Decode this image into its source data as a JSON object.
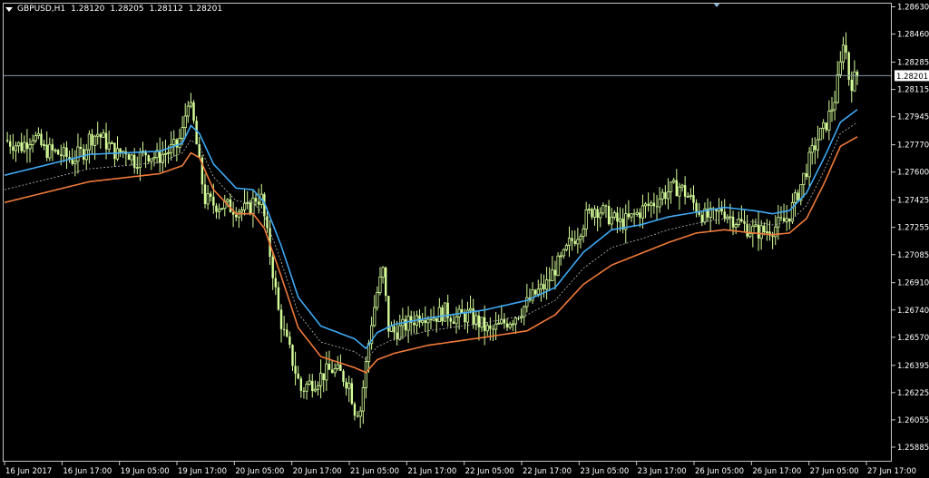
{
  "header": {
    "symbol": "GBPUSD,H1",
    "open": "1.28120",
    "high": "1.28205",
    "low": "1.28112",
    "close": "1.28201",
    "menu_icon": "triangle-down-icon"
  },
  "colors": {
    "background": "#000000",
    "candle": "#d6ff9a",
    "upper_band": "#3fa9f5",
    "lower_band": "#f07a3a",
    "middle_band": "#bbbbbb",
    "grid": "#c8c8c8",
    "current_price_line": "#8896a8"
  },
  "chart_data": {
    "type": "candlestick",
    "current_price": 1.28201,
    "current_price_label": "1.28201",
    "ylim": [
      1.258,
      1.2865
    ],
    "y_ticks": [
      "1.28630",
      "1.28460",
      "1.28285",
      "1.28115",
      "1.27945",
      "1.27770",
      "1.27600",
      "1.27425",
      "1.27255",
      "1.27085",
      "1.26910",
      "1.26740",
      "1.26570",
      "1.26395",
      "1.26225",
      "1.26055",
      "1.25885"
    ],
    "x_labels": [
      "16 Jun 2017",
      "16 Jun 17:00",
      "19 Jun 05:00",
      "19 Jun 17:00",
      "20 Jun 05:00",
      "20 Jun 17:00",
      "21 Jun 05:00",
      "21 Jun 17:00",
      "22 Jun 05:00",
      "22 Jun 17:00",
      "23 Jun 05:00",
      "23 Jun 17:00",
      "26 Jun 05:00",
      "26 Jun 17:00",
      "27 Jun 05:00",
      "27 Jun 17:00"
    ],
    "close_path": [
      [
        0,
        1.278
      ],
      [
        6,
        1.2776
      ],
      [
        10,
        1.2783
      ],
      [
        14,
        1.2774
      ],
      [
        20,
        1.2771
      ],
      [
        24,
        1.2768
      ],
      [
        28,
        1.2773
      ],
      [
        30,
        1.2781
      ],
      [
        33,
        1.2784
      ],
      [
        36,
        1.2778
      ],
      [
        40,
        1.2771
      ],
      [
        43,
        1.2774
      ],
      [
        46,
        1.2767
      ],
      [
        50,
        1.2772
      ],
      [
        54,
        1.2769
      ],
      [
        58,
        1.2773
      ],
      [
        61,
        1.2776
      ],
      [
        63,
        1.2785
      ],
      [
        65,
        1.2806
      ],
      [
        67,
        1.279
      ],
      [
        69,
        1.2764
      ],
      [
        71,
        1.2743
      ],
      [
        74,
        1.274
      ],
      [
        78,
        1.2739
      ],
      [
        82,
        1.2737
      ],
      [
        86,
        1.2736
      ],
      [
        89,
        1.2744
      ],
      [
        91,
        1.2743
      ],
      [
        93,
        1.272
      ],
      [
        95,
        1.2698
      ],
      [
        97,
        1.2673
      ],
      [
        99,
        1.2659
      ],
      [
        101,
        1.2648
      ],
      [
        103,
        1.2636
      ],
      [
        105,
        1.2624
      ],
      [
        107,
        1.2627
      ],
      [
        110,
        1.263
      ],
      [
        113,
        1.2634
      ],
      [
        116,
        1.2637
      ],
      [
        119,
        1.2634
      ],
      [
        122,
        1.2628
      ],
      [
        124,
        1.2612
      ],
      [
        126,
        1.2612
      ],
      [
        128,
        1.264
      ],
      [
        130,
        1.2667
      ],
      [
        132,
        1.2685
      ],
      [
        134,
        1.2698
      ],
      [
        135,
        1.268
      ],
      [
        136,
        1.2663
      ],
      [
        138,
        1.266
      ],
      [
        141,
        1.2663
      ],
      [
        144,
        1.2667
      ],
      [
        148,
        1.2672
      ],
      [
        152,
        1.267
      ],
      [
        156,
        1.2673
      ],
      [
        160,
        1.2669
      ],
      [
        164,
        1.2671
      ],
      [
        168,
        1.2666
      ],
      [
        172,
        1.266
      ],
      [
        176,
        1.2665
      ],
      [
        180,
        1.2669
      ],
      [
        184,
        1.2676
      ],
      [
        188,
        1.2684
      ],
      [
        192,
        1.269
      ],
      [
        195,
        1.27
      ],
      [
        198,
        1.2707
      ],
      [
        200,
        1.2715
      ],
      [
        203,
        1.2722
      ],
      [
        206,
        1.2732
      ],
      [
        209,
        1.2738
      ],
      [
        212,
        1.2735
      ],
      [
        215,
        1.2731
      ],
      [
        218,
        1.2728
      ],
      [
        221,
        1.273
      ],
      [
        224,
        1.2734
      ],
      [
        227,
        1.2738
      ],
      [
        230,
        1.2741
      ],
      [
        233,
        1.2746
      ],
      [
        236,
        1.2749
      ],
      [
        239,
        1.2751
      ],
      [
        242,
        1.2745
      ],
      [
        245,
        1.2738
      ],
      [
        248,
        1.2732
      ],
      [
        251,
        1.2732
      ],
      [
        254,
        1.2737
      ],
      [
        257,
        1.2732
      ],
      [
        260,
        1.2729
      ],
      [
        263,
        1.2725
      ],
      [
        266,
        1.2723
      ],
      [
        269,
        1.2723
      ],
      [
        272,
        1.2725
      ],
      [
        274,
        1.2727
      ],
      [
        276,
        1.2729
      ],
      [
        278,
        1.2734
      ],
      [
        280,
        1.2742
      ],
      [
        282,
        1.2752
      ],
      [
        284,
        1.2762
      ],
      [
        286,
        1.2772
      ],
      [
        288,
        1.2781
      ],
      [
        290,
        1.2786
      ],
      [
        292,
        1.2795
      ],
      [
        294,
        1.2806
      ],
      [
        296,
        1.2826
      ],
      [
        297,
        1.2843
      ],
      [
        298,
        1.2834
      ],
      [
        299,
        1.2819
      ],
      [
        300,
        1.2816
      ],
      [
        302,
        1.282
      ]
    ],
    "x_max": 302,
    "upper_band": [
      [
        0,
        1.2758
      ],
      [
        30,
        1.2771
      ],
      [
        55,
        1.2773
      ],
      [
        63,
        1.2778
      ],
      [
        66,
        1.2789
      ],
      [
        69,
        1.2784
      ],
      [
        74,
        1.2765
      ],
      [
        82,
        1.275
      ],
      [
        88,
        1.2749
      ],
      [
        92,
        1.2741
      ],
      [
        98,
        1.2714
      ],
      [
        104,
        1.2682
      ],
      [
        112,
        1.2664
      ],
      [
        124,
        1.2656
      ],
      [
        128,
        1.265
      ],
      [
        132,
        1.266
      ],
      [
        138,
        1.2665
      ],
      [
        150,
        1.2669
      ],
      [
        170,
        1.2674
      ],
      [
        185,
        1.268
      ],
      [
        195,
        1.2688
      ],
      [
        205,
        1.271
      ],
      [
        215,
        1.2724
      ],
      [
        225,
        1.2727
      ],
      [
        235,
        1.2732
      ],
      [
        245,
        1.2735
      ],
      [
        255,
        1.2738
      ],
      [
        265,
        1.2736
      ],
      [
        272,
        1.2734
      ],
      [
        278,
        1.2736
      ],
      [
        284,
        1.2747
      ],
      [
        290,
        1.2768
      ],
      [
        296,
        1.2791
      ],
      [
        302,
        1.2799
      ]
    ],
    "middle_band": [
      [
        0,
        1.2749
      ],
      [
        30,
        1.2762
      ],
      [
        55,
        1.2766
      ],
      [
        63,
        1.2772
      ],
      [
        66,
        1.278
      ],
      [
        69,
        1.2776
      ],
      [
        74,
        1.2757
      ],
      [
        82,
        1.2742
      ],
      [
        88,
        1.2741
      ],
      [
        92,
        1.2733
      ],
      [
        98,
        1.2704
      ],
      [
        104,
        1.2672
      ],
      [
        112,
        1.2654
      ],
      [
        124,
        1.2648
      ],
      [
        128,
        1.2643
      ],
      [
        132,
        1.2651
      ],
      [
        138,
        1.2656
      ],
      [
        150,
        1.2661
      ],
      [
        170,
        1.2666
      ],
      [
        185,
        1.2671
      ],
      [
        195,
        1.268
      ],
      [
        205,
        1.27
      ],
      [
        215,
        1.2713
      ],
      [
        225,
        1.2718
      ],
      [
        235,
        1.2724
      ],
      [
        245,
        1.2728
      ],
      [
        255,
        1.2731
      ],
      [
        265,
        1.2729
      ],
      [
        272,
        1.2727
      ],
      [
        278,
        1.2729
      ],
      [
        284,
        1.2739
      ],
      [
        290,
        1.276
      ],
      [
        296,
        1.2784
      ],
      [
        302,
        1.2791
      ]
    ],
    "lower_band": [
      [
        0,
        1.2741
      ],
      [
        30,
        1.2754
      ],
      [
        55,
        1.2759
      ],
      [
        63,
        1.2764
      ],
      [
        66,
        1.2772
      ],
      [
        69,
        1.2769
      ],
      [
        74,
        1.2749
      ],
      [
        82,
        1.2734
      ],
      [
        88,
        1.2734
      ],
      [
        92,
        1.2725
      ],
      [
        98,
        1.2695
      ],
      [
        104,
        1.2663
      ],
      [
        112,
        1.2645
      ],
      [
        124,
        1.2638
      ],
      [
        128,
        1.2635
      ],
      [
        132,
        1.2643
      ],
      [
        138,
        1.2647
      ],
      [
        150,
        1.2652
      ],
      [
        170,
        1.2657
      ],
      [
        185,
        1.2661
      ],
      [
        195,
        1.2671
      ],
      [
        205,
        1.269
      ],
      [
        215,
        1.2702
      ],
      [
        225,
        1.2709
      ],
      [
        235,
        1.2716
      ],
      [
        245,
        1.2722
      ],
      [
        255,
        1.2724
      ],
      [
        265,
        1.2722
      ],
      [
        272,
        1.2721
      ],
      [
        278,
        1.2722
      ],
      [
        284,
        1.2731
      ],
      [
        290,
        1.2752
      ],
      [
        296,
        1.2776
      ],
      [
        302,
        1.2782
      ]
    ]
  }
}
